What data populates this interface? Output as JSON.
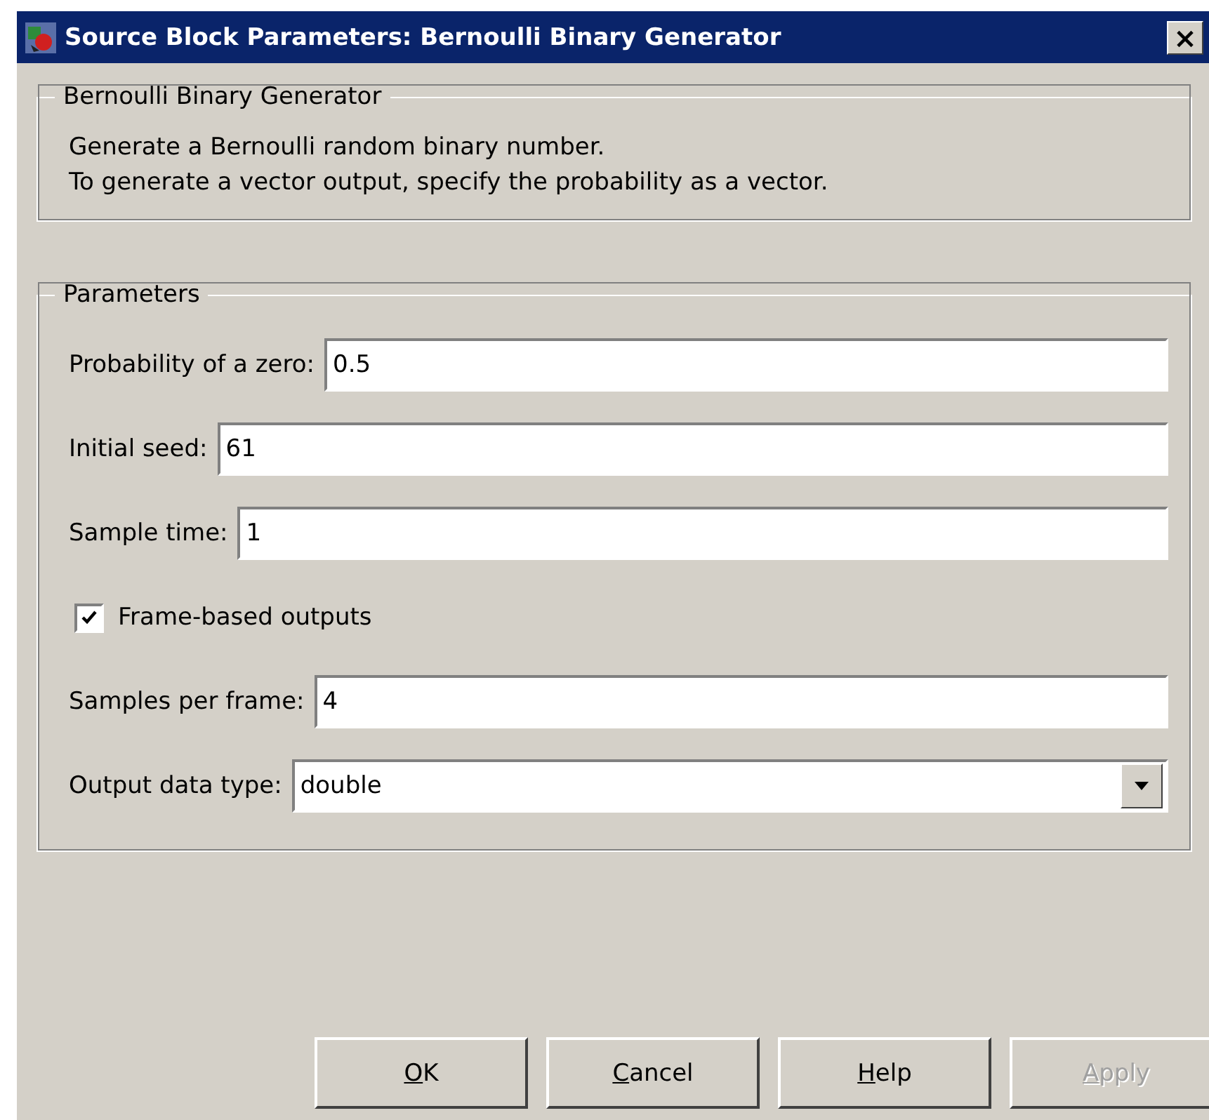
{
  "window": {
    "title": "Source Block Parameters: Bernoulli Binary Generator",
    "close": "×"
  },
  "description": {
    "legend": "Bernoulli Binary Generator",
    "lines": [
      "Generate a Bernoulli random binary number.",
      "To generate a vector output, specify the probability as a vector."
    ]
  },
  "parameters": {
    "legend": "Parameters",
    "items": [
      {
        "kind": "text",
        "label": "Probability of a zero:",
        "value": "0.5"
      },
      {
        "kind": "text",
        "label": "Initial seed:",
        "value": "61"
      },
      {
        "kind": "text",
        "label": "Sample time:",
        "value": "1"
      },
      {
        "kind": "checkbox",
        "label": "Frame-based outputs",
        "checked": true
      },
      {
        "kind": "text",
        "label": "Samples per frame:",
        "value": "4"
      },
      {
        "kind": "dropdown",
        "label": "Output data type:",
        "value": "double"
      }
    ]
  },
  "buttons": [
    {
      "label": "OK",
      "disabled": false
    },
    {
      "label": "Cancel",
      "disabled": false
    },
    {
      "label": "Help",
      "disabled": false
    },
    {
      "label": "Apply",
      "disabled": true
    }
  ]
}
